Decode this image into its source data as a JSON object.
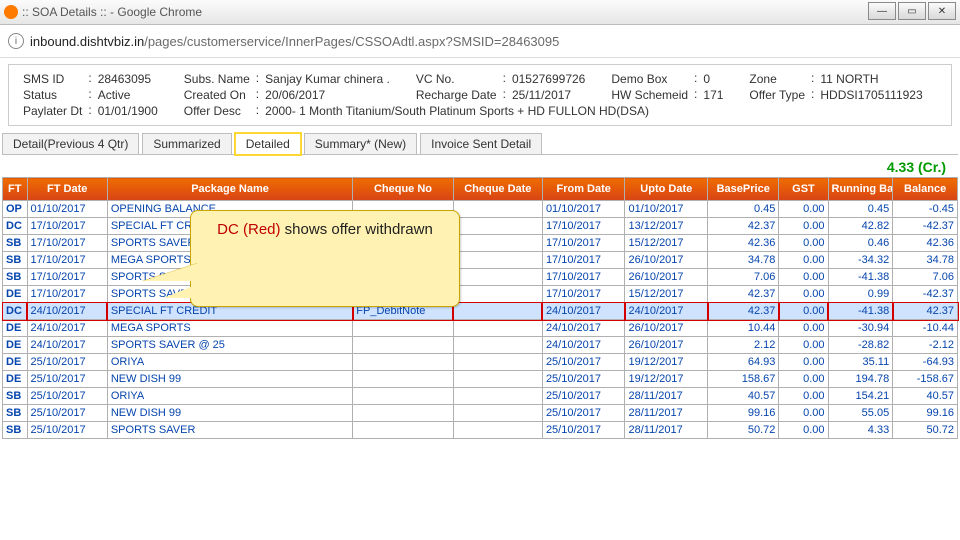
{
  "window": {
    "title": ":: SOA Details :: - Google Chrome"
  },
  "address": {
    "host": "inbound.dishtvbiz.in",
    "path": "/pages/customerservice/InnerPages/CSSOAdtl.aspx?SMSID=28463095"
  },
  "header": {
    "f1": {
      "l": "SMS ID",
      "v": "28463095"
    },
    "f2": {
      "l": "Subs. Name",
      "v": "Sanjay Kumar chinera ."
    },
    "f3": {
      "l": "VC No.",
      "v": "01527699726"
    },
    "f4": {
      "l": "Demo Box",
      "v": "0"
    },
    "f5": {
      "l": "Zone",
      "v": "11 NORTH"
    },
    "f6": {
      "l": "Status",
      "v": "Active"
    },
    "f7": {
      "l": "Created On",
      "v": "20/06/2017"
    },
    "f8": {
      "l": "Recharge Date",
      "v": "25/11/2017"
    },
    "f9": {
      "l": "HW Schemeid",
      "v": "171"
    },
    "f10": {
      "l": "Offer Type",
      "v": "HDDSI1705111923"
    },
    "f11": {
      "l": "Paylater Dt",
      "v": "01/01/1900"
    },
    "f12": {
      "l": "Offer Desc",
      "v": "2000- 1 Month Titanium/South Platinum Sports + HD FULLON HD(DSA)"
    }
  },
  "tabs": {
    "t1": "Detail(Previous 4 Qtr)",
    "t2": "Summarized",
    "t3": "Detailed",
    "t4": "Summary* (New)",
    "t5": "Invoice Sent Detail"
  },
  "credit": "4.33 (Cr.)",
  "cols": {
    "c1": "FT",
    "c2": "FT Date",
    "c3": "Package Name",
    "c4": "Cheque No",
    "c5": "Cheque Date",
    "c6": "From Date",
    "c7": "Upto Date",
    "c8": "BasePrice",
    "c9": "GST",
    "c10": "Running Balance",
    "c11": "Balance"
  },
  "callout": {
    "red": "DC (Red)",
    "rest": " shows offer withdrawn"
  },
  "rows": [
    {
      "ft": "OP",
      "date": "01/10/2017",
      "pkg": "OPENING BALANCE",
      "cno": "",
      "cdate": "",
      "from": "01/10/2017",
      "upto": "01/10/2017",
      "base": "0.45",
      "gst": "0.00",
      "run": "0.45",
      "bal": "-0.45"
    },
    {
      "ft": "DC",
      "date": "17/10/2017",
      "pkg": "SPECIAL FT CREDIT",
      "cno": "",
      "cdate": "",
      "from": "17/10/2017",
      "upto": "13/12/2017",
      "base": "42.37",
      "gst": "0.00",
      "run": "42.82",
      "bal": "-42.37"
    },
    {
      "ft": "SB",
      "date": "17/10/2017",
      "pkg": "SPORTS SAVER",
      "cno": "",
      "cdate": "",
      "from": "17/10/2017",
      "upto": "15/12/2017",
      "base": "42.36",
      "gst": "0.00",
      "run": "0.46",
      "bal": "42.36"
    },
    {
      "ft": "SB",
      "date": "17/10/2017",
      "pkg": "MEGA SPORTS",
      "cno": "",
      "cdate": "",
      "from": "17/10/2017",
      "upto": "26/10/2017",
      "base": "34.78",
      "gst": "0.00",
      "run": "-34.32",
      "bal": "34.78"
    },
    {
      "ft": "SB",
      "date": "17/10/2017",
      "pkg": "SPORTS SAVER @ 25",
      "cno": "",
      "cdate": "",
      "from": "17/10/2017",
      "upto": "26/10/2017",
      "base": "7.06",
      "gst": "0.00",
      "run": "-41.38",
      "bal": "7.06"
    },
    {
      "ft": "DE",
      "date": "17/10/2017",
      "pkg": "SPORTS SAVER @ 25",
      "cno": "",
      "cdate": "",
      "from": "17/10/2017",
      "upto": "15/12/2017",
      "base": "42.37",
      "gst": "0.00",
      "run": "0.99",
      "bal": "-42.37"
    },
    {
      "ft": "DC",
      "date": "24/10/2017",
      "pkg": "SPECIAL FT CREDIT",
      "cno": "FP_DebitNote",
      "cdate": "",
      "from": "24/10/2017",
      "upto": "24/10/2017",
      "base": "42.37",
      "gst": "0.00",
      "run": "-41.38",
      "bal": "42.37",
      "hl": true
    },
    {
      "ft": "DE",
      "date": "24/10/2017",
      "pkg": "MEGA SPORTS",
      "cno": "",
      "cdate": "",
      "from": "24/10/2017",
      "upto": "26/10/2017",
      "base": "10.44",
      "gst": "0.00",
      "run": "-30.94",
      "bal": "-10.44"
    },
    {
      "ft": "DE",
      "date": "24/10/2017",
      "pkg": "SPORTS SAVER @ 25",
      "cno": "",
      "cdate": "",
      "from": "24/10/2017",
      "upto": "26/10/2017",
      "base": "2.12",
      "gst": "0.00",
      "run": "-28.82",
      "bal": "-2.12"
    },
    {
      "ft": "DE",
      "date": "25/10/2017",
      "pkg": "ORIYA",
      "cno": "",
      "cdate": "",
      "from": "25/10/2017",
      "upto": "19/12/2017",
      "base": "64.93",
      "gst": "0.00",
      "run": "35.11",
      "bal": "-64.93"
    },
    {
      "ft": "DE",
      "date": "25/10/2017",
      "pkg": "NEW DISH 99",
      "cno": "",
      "cdate": "",
      "from": "25/10/2017",
      "upto": "19/12/2017",
      "base": "158.67",
      "gst": "0.00",
      "run": "194.78",
      "bal": "-158.67"
    },
    {
      "ft": "SB",
      "date": "25/10/2017",
      "pkg": "ORIYA",
      "cno": "",
      "cdate": "",
      "from": "25/10/2017",
      "upto": "28/11/2017",
      "base": "40.57",
      "gst": "0.00",
      "run": "154.21",
      "bal": "40.57"
    },
    {
      "ft": "SB",
      "date": "25/10/2017",
      "pkg": "NEW DISH 99",
      "cno": "",
      "cdate": "",
      "from": "25/10/2017",
      "upto": "28/11/2017",
      "base": "99.16",
      "gst": "0.00",
      "run": "55.05",
      "bal": "99.16"
    },
    {
      "ft": "SB",
      "date": "25/10/2017",
      "pkg": "SPORTS SAVER",
      "cno": "",
      "cdate": "",
      "from": "25/10/2017",
      "upto": "28/11/2017",
      "base": "50.72",
      "gst": "0.00",
      "run": "4.33",
      "bal": "50.72"
    }
  ]
}
